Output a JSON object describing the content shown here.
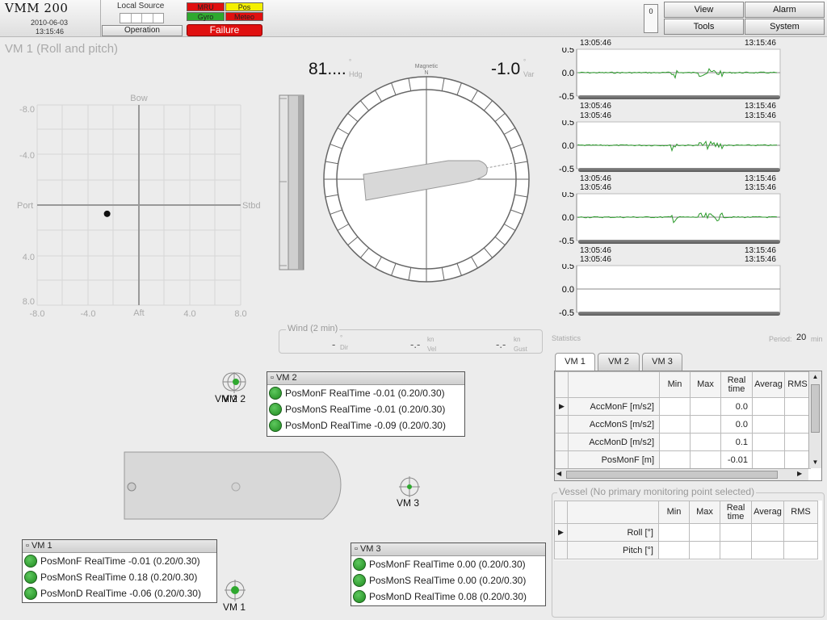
{
  "app": {
    "title": "VMM 200",
    "date": "2010-06-03",
    "time": "13:15:46"
  },
  "status": {
    "local_source_label": "Local Source",
    "operation_label": "Operation",
    "indicators": [
      {
        "label": "MRU",
        "color": "#e01010"
      },
      {
        "label": "Pos",
        "color": "#f4f000"
      },
      {
        "label": "Gyro",
        "color": "#2fa82f"
      },
      {
        "label": "Meteo",
        "color": "#e01010"
      }
    ],
    "failure_label": "Failure",
    "counter": "0"
  },
  "menu": {
    "view": "View",
    "alarm": "Alarm",
    "tools": "Tools",
    "system": "System"
  },
  "panel_title": "VM 1 (Roll and pitch)",
  "roll_pitch": {
    "top_label": "Bow",
    "bottom_label": "Aft",
    "left_label": "Port",
    "right_label": "Stbd",
    "y_ticks": [
      "-8.0",
      "-4.0",
      "4.0",
      "8.0"
    ],
    "x_ticks": [
      "-8.0",
      "-4.0",
      "4.0",
      "8.0"
    ],
    "point": {
      "x": -2.5,
      "y": 0.7
    }
  },
  "compass": {
    "heading_value": "81....",
    "heading_label": "Hdg",
    "variation_value": "-1.0",
    "variation_label": "Var",
    "deg_symbol": "°",
    "north_label": "Magnetic",
    "n_letter": "N"
  },
  "wind": {
    "title": "Wind (2 min)",
    "dir_value": "-",
    "dir_unit": "°",
    "dir_label": "Dir",
    "vel_value": "-.-",
    "vel_unit": "kn",
    "vel_label": "Vel",
    "gust_value": "-.-",
    "gust_unit": "kn",
    "gust_label": "Gust"
  },
  "trends": [
    {
      "start": "13:05:46",
      "end": "13:15:46",
      "ticks": [
        "0.5",
        "0.0",
        "-0.5"
      ]
    },
    {
      "start": "13:05:46",
      "end": "13:15:46",
      "ticks": [
        "0.5",
        "0.0",
        "-0.5"
      ]
    },
    {
      "start": "13:05:46",
      "end": "13:15:46",
      "ticks": [
        "0.5",
        "0.0",
        "-0.5"
      ]
    },
    {
      "start": "13:05:46",
      "end": "13:15:46",
      "ticks": [
        "0.5",
        "0.0",
        "-0.5"
      ]
    }
  ],
  "statistics": {
    "label": "Statistics",
    "period_label": "Period:",
    "period_value": "20",
    "period_unit": "min",
    "tabs": [
      "VM 1",
      "VM 2",
      "VM 3"
    ],
    "columns": [
      "Min",
      "Max",
      "Real time",
      "Averag",
      "RMS"
    ],
    "rows": [
      {
        "label": "AccMonF [m/s2]",
        "real": "0.0"
      },
      {
        "label": "AccMonS [m/s2]",
        "real": "0.0"
      },
      {
        "label": "AccMonD [m/s2]",
        "real": "0.1"
      },
      {
        "label": "PosMonF [m]",
        "real": "-0.01"
      }
    ]
  },
  "vessel": {
    "title": "Vessel (No primary monitoring point selected)",
    "columns": [
      "Min",
      "Max",
      "Real time",
      "Averag",
      "RMS"
    ],
    "rows": [
      {
        "label": "Roll [°]"
      },
      {
        "label": "Pitch [°]"
      }
    ]
  },
  "monitors": {
    "vm1": {
      "title": "VM 1",
      "rows": [
        "PosMonF RealTime -0.01 (0.20/0.30)",
        "PosMonS RealTime 0.18 (0.20/0.30)",
        "PosMonD RealTime -0.06 (0.20/0.30)"
      ]
    },
    "vm2": {
      "title": "VM 2",
      "rows": [
        "PosMonF RealTime -0.01 (0.20/0.30)",
        "PosMonS RealTime -0.01 (0.20/0.30)",
        "PosMonD RealTime -0.09 (0.20/0.30)"
      ]
    },
    "vm3": {
      "title": "VM 3",
      "rows": [
        "PosMonF RealTime 0.00 (0.20/0.30)",
        "PosMonS RealTime 0.00 (0.20/0.30)",
        "PosMonD RealTime 0.08 (0.20/0.30)"
      ]
    },
    "marker_labels": {
      "vm1": "VM 1",
      "vm2": "VM 2",
      "vm3": "VM 3"
    }
  }
}
